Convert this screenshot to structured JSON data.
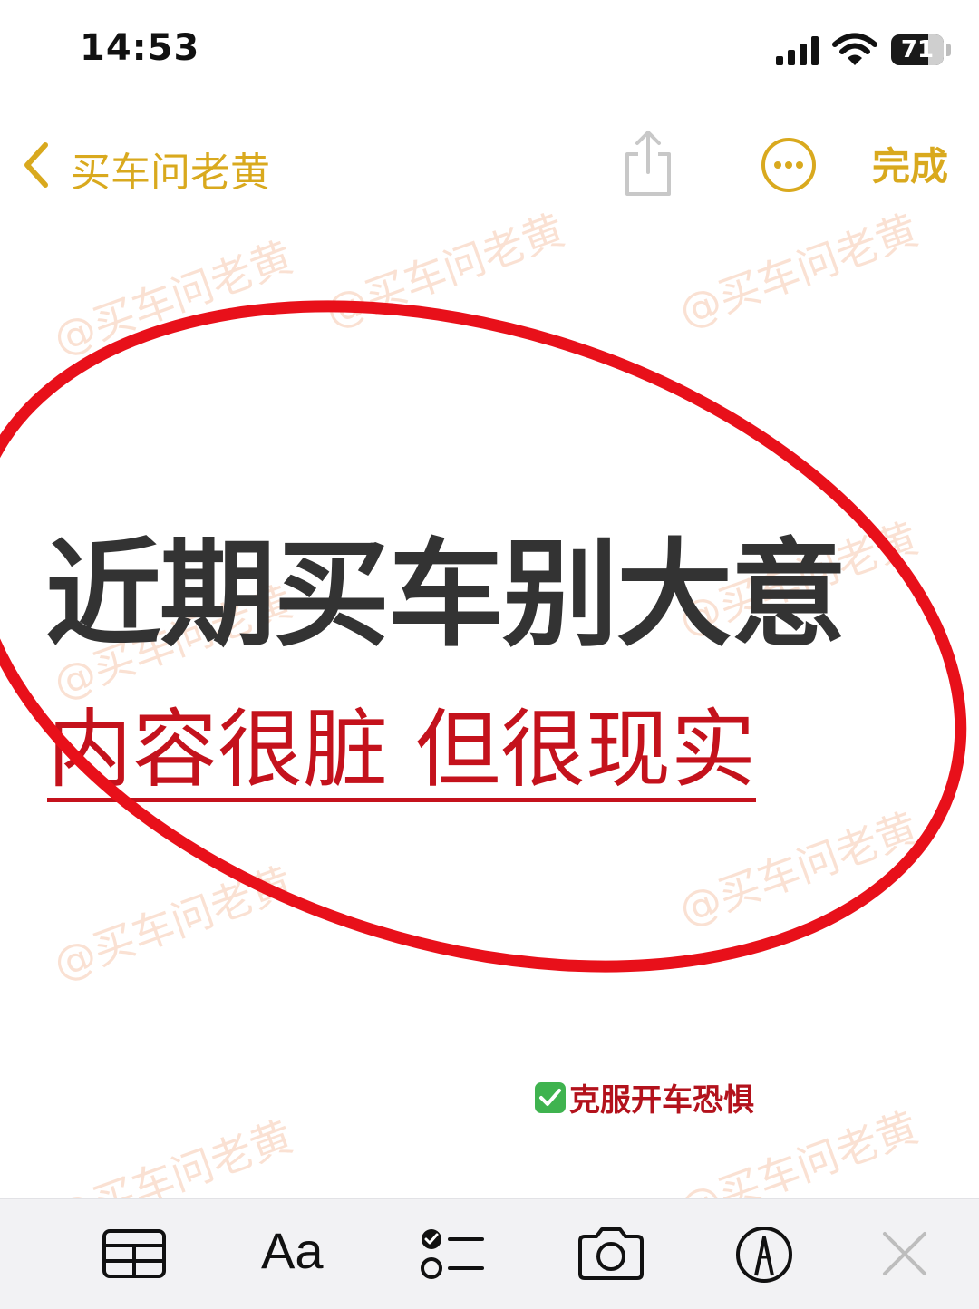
{
  "status_bar": {
    "time": "14:53",
    "battery": "71",
    "battery_level": 0.71
  },
  "nav": {
    "back_label": "买车问老黄",
    "done_label": "完成"
  },
  "watermark_text": "@买车问老黄",
  "content": {
    "headline": "近期买车别大意",
    "subheadline": "内容很脏 但很现实",
    "tip": "克服开车恐惧"
  },
  "toolbar": {
    "format_label": "Aa"
  },
  "colors": {
    "accent": "#d9a91e",
    "headline": "#333333",
    "subheadline_red": "#c4121c",
    "circle_red": "#e8101a",
    "check_green": "#3fb34f"
  }
}
